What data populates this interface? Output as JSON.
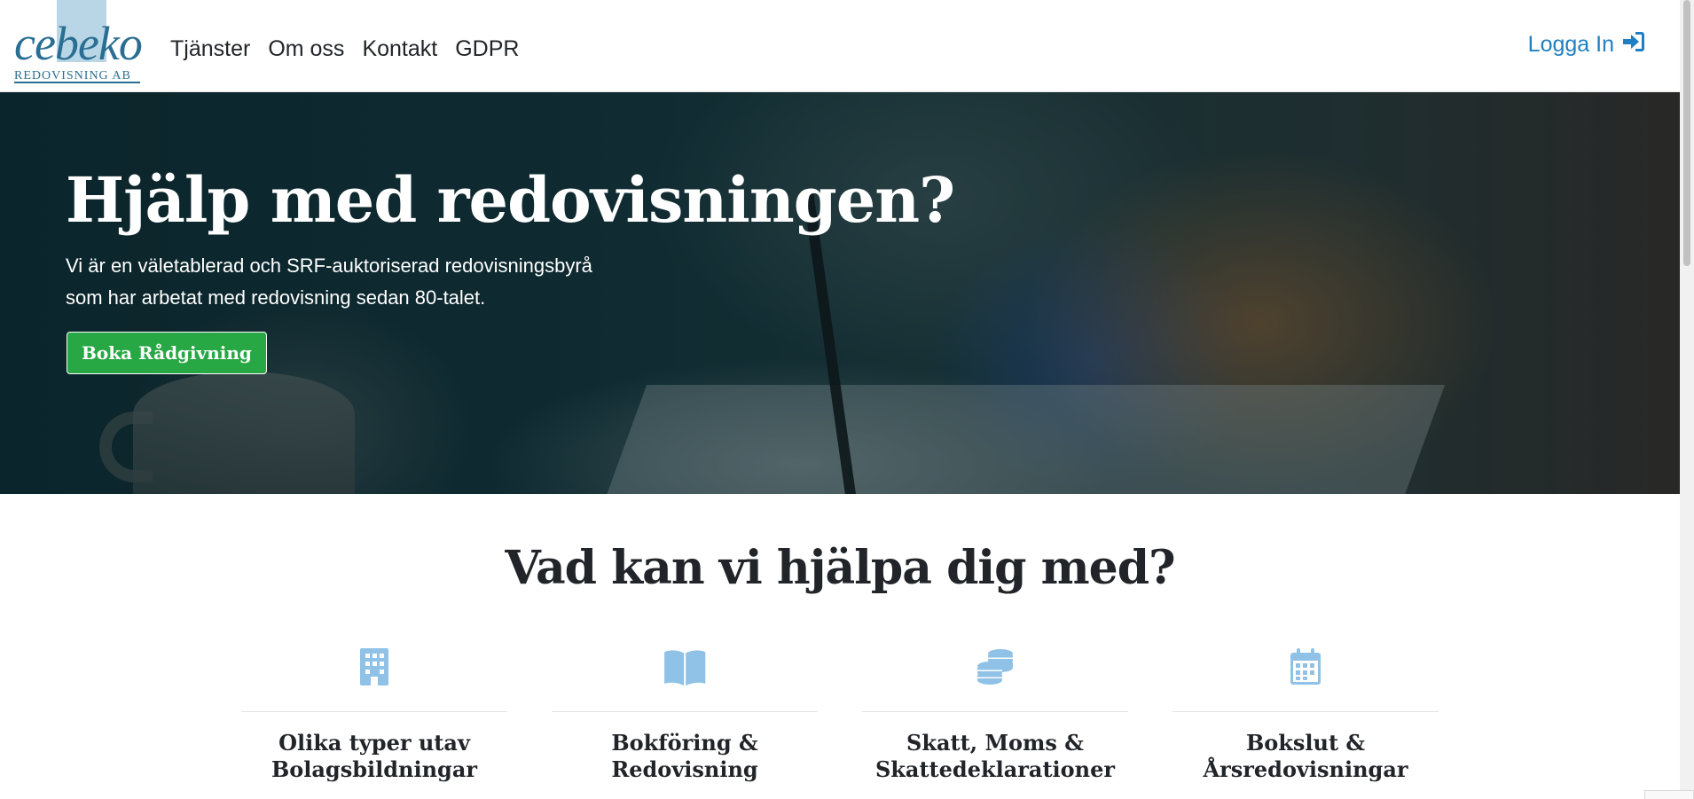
{
  "brand": {
    "name": "cebeko",
    "sub": "REDOVISNING AB"
  },
  "nav": {
    "items": [
      {
        "label": "Tjänster"
      },
      {
        "label": "Om oss"
      },
      {
        "label": "Kontakt"
      },
      {
        "label": "GDPR"
      }
    ],
    "login_label": "Logga In",
    "login_icon": "sign-in-icon"
  },
  "hero": {
    "title": "Hjälp med redovisningen?",
    "line1": "Vi är en väletablerad och SRF-auktoriserad redovisningsbyrå",
    "line2": "som har arbetat med redovisning sedan 80-talet.",
    "cta": "Boka Rådgivning"
  },
  "services": {
    "title": "Vad kan vi hjälpa dig med?",
    "cards": [
      {
        "icon": "building-icon",
        "line1": "Olika typer utav",
        "line2": "Bolagsbildningar"
      },
      {
        "icon": "book-open-icon",
        "line1": "Bokföring &",
        "line2": "Redovisning"
      },
      {
        "icon": "coins-icon",
        "line1": "Skatt, Moms &",
        "line2": "Skattedeklarationer"
      },
      {
        "icon": "calendar-icon",
        "line1": "Bokslut &",
        "line2": "Årsredovisningar"
      }
    ]
  },
  "colors": {
    "accent": "#1f7fc2",
    "icon": "#8fc2e6",
    "cta": "#28a745",
    "brand": "#2a6f93"
  }
}
